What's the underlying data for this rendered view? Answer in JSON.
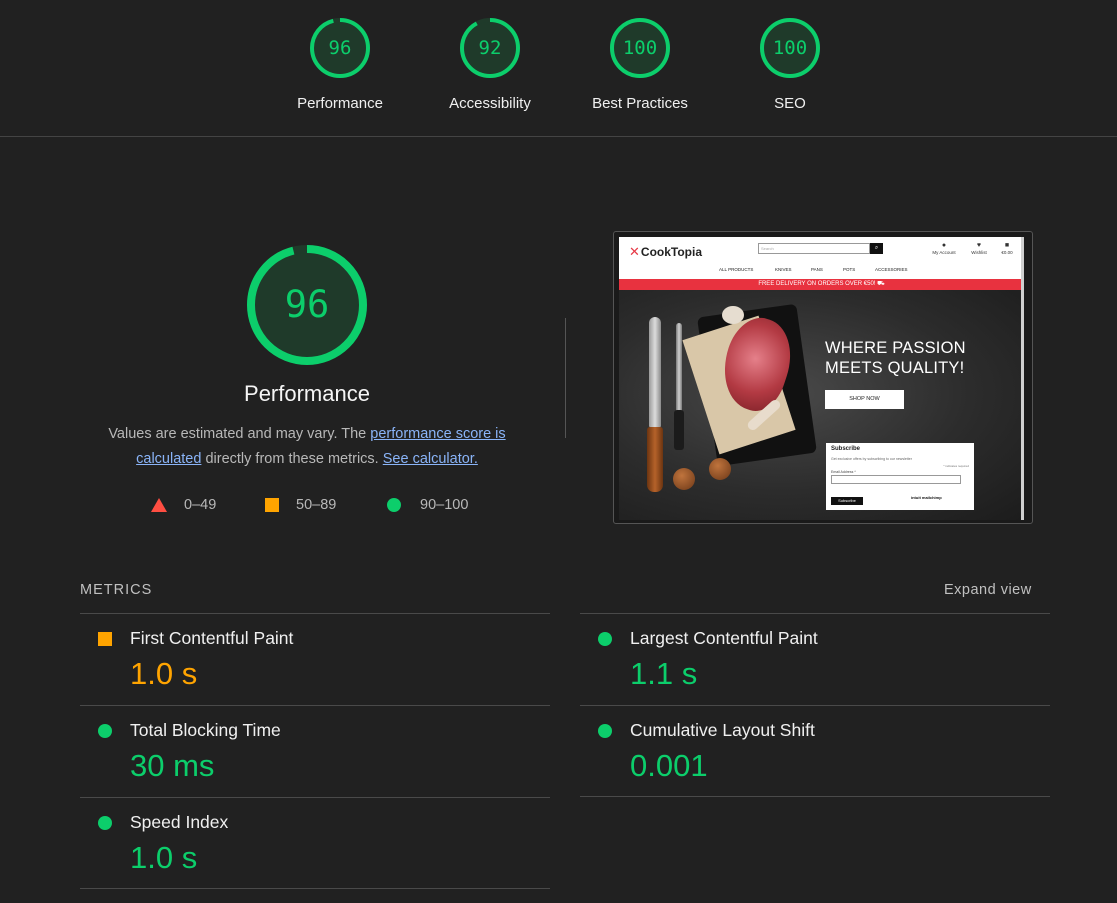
{
  "categories": [
    {
      "label": "Performance",
      "score": "96",
      "value": 96
    },
    {
      "label": "Accessibility",
      "score": "92",
      "value": 92
    },
    {
      "label": "Best Practices",
      "score": "100",
      "value": 100
    },
    {
      "label": "SEO",
      "score": "100",
      "value": 100
    }
  ],
  "main": {
    "score": "96",
    "value": 96,
    "title": "Performance",
    "desc_pre": "Values are estimated and may vary. The ",
    "desc_link1": "performance score is calculated",
    "desc_mid": " directly from these metrics. ",
    "desc_link2": "See calculator."
  },
  "legend": {
    "fail": "0–49",
    "average": "50–89",
    "pass": "90–100"
  },
  "colors": {
    "pass": "#0cce6b",
    "average": "#ffa400",
    "fail": "#ff4e42",
    "link": "#8ab4f8",
    "background": "#212121"
  },
  "thumbnail": {
    "logo": "CookTopia",
    "search_placeholder": "Search",
    "search_button_icon": "search-icon",
    "icons": [
      "My Account",
      "Wishlist",
      "€0.00"
    ],
    "nav": [
      "ALL PRODUCTS",
      "KNIVES",
      "PANS",
      "POTS",
      "ACCESSORIES"
    ],
    "banner": "FREE DELIVERY ON ORDERS OVER €50! ⛟",
    "hero_line1": "WHERE PASSION",
    "hero_line2": "MEETS QUALITY!",
    "cta": "SHOP NOW",
    "subscribe": {
      "title": "Subscribe",
      "desc": "Get exclusive offers by subscribing to our newsletter",
      "required": "* indicates required",
      "email_label": "Email Address *",
      "button": "Subscribe",
      "badge": "intuit mailchimp"
    }
  },
  "metrics": {
    "heading": "METRICS",
    "expand": "Expand view",
    "items": [
      {
        "name": "First Contentful Paint",
        "value": "1.0 s",
        "rating": "average"
      },
      {
        "name": "Largest Contentful Paint",
        "value": "1.1 s",
        "rating": "pass"
      },
      {
        "name": "Total Blocking Time",
        "value": "30 ms",
        "rating": "pass"
      },
      {
        "name": "Cumulative Layout Shift",
        "value": "0.001",
        "rating": "pass"
      },
      {
        "name": "Speed Index",
        "value": "1.0 s",
        "rating": "pass"
      }
    ]
  }
}
